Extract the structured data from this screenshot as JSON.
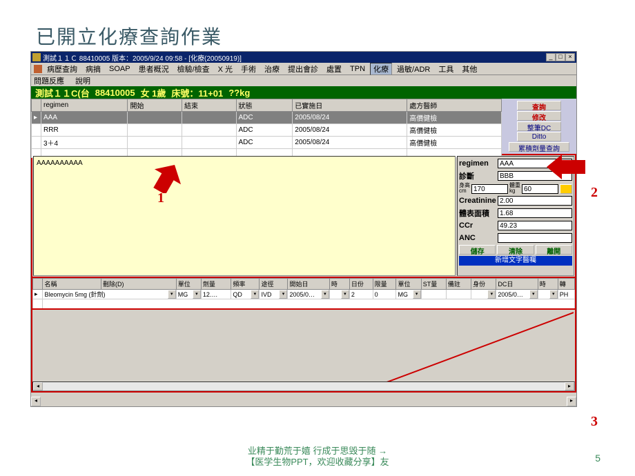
{
  "slide": {
    "title": "已開立化療查詢作業",
    "page_number": "5"
  },
  "window": {
    "title": "測試１１Ｃ 88410005 版本：2005/9/24 09:58 - [化療(20050919)]"
  },
  "menu": {
    "items": [
      "病歷查詢",
      "病摘",
      "SOAP",
      "患者概況",
      "檢驗/檢查",
      "X 光",
      "手術",
      "治療",
      "提出會診",
      "處置",
      "TPN",
      "化療",
      "過敏/ADR",
      "工具",
      "其他"
    ],
    "active": "化療",
    "row2": [
      "問題反應",
      "說明"
    ]
  },
  "patient": {
    "name": "測試１１C(台",
    "id": "88410005",
    "sex_age": "女 1歲",
    "bed_label": "床號：11+01",
    "weight": "??kg"
  },
  "regimen_grid": {
    "cols": [
      "regimen",
      "開始",
      "結束",
      "狀態",
      "已實施日",
      "處方醫師"
    ],
    "rows": [
      {
        "regimen": "AAA",
        "start": "",
        "end": "",
        "status": "ADC",
        "date": "2005/08/24",
        "doctor": "高價健檢",
        "selected": true
      },
      {
        "regimen": "RRR",
        "start": "",
        "end": "",
        "status": "ADC",
        "date": "2005/08/24",
        "doctor": "高價健檢",
        "selected": false
      },
      {
        "regimen": "3＋4",
        "start": "",
        "end": "",
        "status": "ADC",
        "date": "2005/08/24",
        "doctor": "高價健檢",
        "selected": false
      }
    ]
  },
  "buttons": {
    "query": "查詢",
    "modify": "修改",
    "whole_dc": "整筆DC",
    "ditto": "Ditto",
    "review": "累積劑量查詢"
  },
  "memo": {
    "text": "AAAAAAAAAA"
  },
  "info": {
    "regimen_label": "regimen",
    "regimen": "AAA",
    "dx_label": "診斷",
    "dx": "BBB",
    "height_lbl1": "身高",
    "height_lbl2": "cm",
    "height": "170",
    "weight_lbl1": "體重",
    "weight_lbl2": "kg",
    "weight": "60",
    "cr_label": "Creatinine",
    "cr": "2.00",
    "bsa_label": "體表面積",
    "bsa": "1.68",
    "ccr_label": "CCr",
    "ccr": "49.23",
    "anc_label": "ANC",
    "anc": "",
    "btn_save": "儲存",
    "btn_clear": "清除",
    "btn_leave": "離開",
    "newfield": "新增文字醫囑"
  },
  "drug_grid": {
    "cols": [
      "",
      "名稱",
      "刪除(D)",
      "單位",
      "劑量",
      "頻率",
      "途徑",
      "開始日",
      "時",
      "日份",
      "限量",
      "單位",
      "ST量",
      "備註",
      "身份",
      "DC日",
      "時",
      "轉"
    ],
    "row": {
      "marker": "▸",
      "name": "Bleomycin 5mg (針劑)",
      "unit1": "MG",
      "dose": "12.…",
      "freq": "QD",
      "route": "IVD",
      "start": "2005/0…",
      "time1": "",
      "days": "2",
      "limit": "0",
      "unit2": "MG",
      "st": "",
      "note": "",
      "ident": "",
      "dc": "2005/0…",
      "time2": "",
      "tr": "PH"
    }
  },
  "footer": {
    "line1": "业精于勤荒于嬉 行成于思毁于随 →",
    "line2": "【医学生物PPT，欢迎收藏分享】友"
  },
  "annotations": {
    "n1": "1",
    "n2": "2",
    "n3": "3"
  }
}
